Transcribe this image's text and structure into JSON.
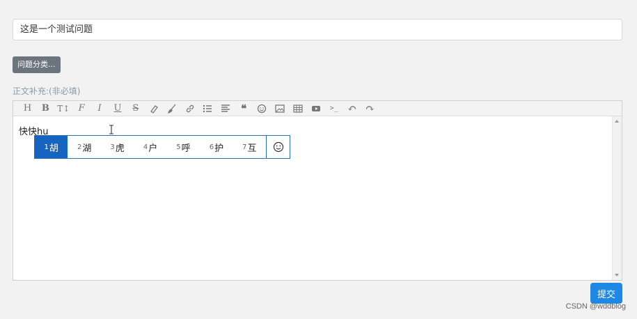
{
  "question": {
    "title_value": "这是一个测试问题"
  },
  "category_button": {
    "label": "问题分类..."
  },
  "body_label": "正文补充:(非必填)",
  "toolbar": {
    "items": [
      {
        "name": "heading-icon",
        "glyph": "H"
      },
      {
        "name": "bold-icon",
        "glyph": "B"
      },
      {
        "name": "text-size-icon",
        "glyph": "T↕"
      },
      {
        "name": "font-icon",
        "glyph": "F"
      },
      {
        "name": "italic-icon",
        "glyph": "I"
      },
      {
        "name": "underline-icon",
        "glyph": "U"
      },
      {
        "name": "strikethrough-icon",
        "glyph": "S"
      },
      {
        "name": "eraser-icon",
        "glyph": ""
      },
      {
        "name": "brush-icon",
        "glyph": ""
      },
      {
        "name": "link-icon",
        "glyph": ""
      },
      {
        "name": "list-icon",
        "glyph": ""
      },
      {
        "name": "align-icon",
        "glyph": ""
      },
      {
        "name": "quote-icon",
        "glyph": "❝"
      },
      {
        "name": "emoji-icon",
        "glyph": "☺"
      },
      {
        "name": "image-icon",
        "glyph": ""
      },
      {
        "name": "table-icon",
        "glyph": ""
      },
      {
        "name": "video-icon",
        "glyph": ""
      },
      {
        "name": "code-icon",
        "glyph": ">_"
      },
      {
        "name": "undo-icon",
        "glyph": "↶"
      },
      {
        "name": "redo-icon",
        "glyph": "↷"
      }
    ]
  },
  "editor": {
    "committed_text": "快快",
    "composition_text": "hu"
  },
  "ime": {
    "candidates": [
      {
        "num": "1",
        "text": "胡"
      },
      {
        "num": "2",
        "text": "湖"
      },
      {
        "num": "3",
        "text": "虎"
      },
      {
        "num": "4",
        "text": "户"
      },
      {
        "num": "5",
        "text": "呼"
      },
      {
        "num": "6",
        "text": "护"
      },
      {
        "num": "7",
        "text": "互"
      }
    ]
  },
  "submit_button": {
    "label": "提交"
  },
  "watermark": "CSDN @wddblog",
  "colors": {
    "submit": "#1e88e5",
    "ime_selected": "#1565c0",
    "category_button": "#6c757d"
  }
}
